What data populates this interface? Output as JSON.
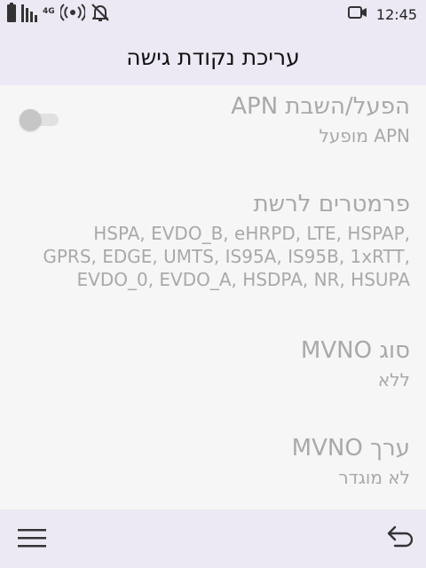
{
  "status_bar": {
    "network": "4G",
    "time": "12:45",
    "icons": [
      "battery-icon",
      "signal-icon",
      "hotspot-icon",
      "notifications-off-icon",
      "video-camera-icon"
    ]
  },
  "header": {
    "title": "עריכת נקודת גישה"
  },
  "settings": {
    "apn_toggle": {
      "title": "הפעל/השבת APN",
      "summary": "APN מופעל",
      "enabled": false
    },
    "bearer": {
      "title": "פרמטרים לרשת",
      "summary_lines": [
        "HSPA, EVDO_B, eHRPD, LTE, HSPAP,",
        "GPRS, EDGE, UMTS, IS95A, IS95B, 1xRTT,",
        "EVDO_0, EVDO_A, HSDPA, NR, HSUPA"
      ]
    },
    "mvno_type": {
      "title": "סוג MVNO",
      "summary": "ללא"
    },
    "mvno_value": {
      "title": "ערך MVNO",
      "summary": "לא מוגדר"
    }
  },
  "bottom_bar": {
    "icons": [
      "menu-icon",
      "back-icon"
    ]
  }
}
